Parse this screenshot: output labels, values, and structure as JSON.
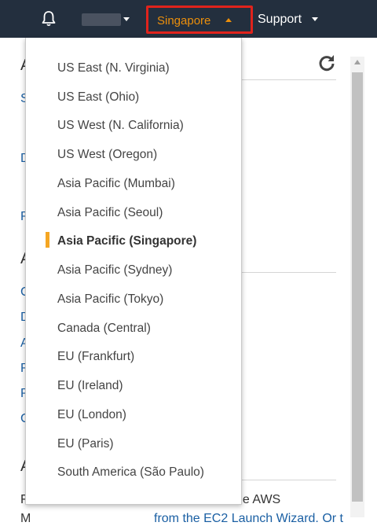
{
  "topnav": {
    "account_label": "",
    "region_label": "Singapore",
    "support_label": "Support"
  },
  "background": {
    "bottom_text_1": "F",
    "bottom_text_1_tail": "ne AWS",
    "bottom_text_2": "M",
    "bottom_text_2_tail": "from the EC2 Launch Wizard. Or t"
  },
  "region_menu": {
    "selected": "Asia Pacific (Singapore)",
    "items": [
      {
        "label": "US East (N. Virginia)"
      },
      {
        "label": "US East (Ohio)"
      },
      {
        "label": "US West (N. California)"
      },
      {
        "label": "US West (Oregon)"
      },
      {
        "label": "Asia Pacific (Mumbai)"
      },
      {
        "label": "Asia Pacific (Seoul)"
      },
      {
        "label": "Asia Pacific (Singapore)"
      },
      {
        "label": "Asia Pacific (Sydney)"
      },
      {
        "label": "Asia Pacific (Tokyo)"
      },
      {
        "label": "Canada (Central)"
      },
      {
        "label": "EU (Frankfurt)"
      },
      {
        "label": "EU (Ireland)"
      },
      {
        "label": "EU (London)"
      },
      {
        "label": "EU (Paris)"
      },
      {
        "label": "South America (São Paulo)"
      }
    ]
  },
  "colors": {
    "topbar": "#232f3e",
    "region_accent": "#ec8f0b",
    "highlight_border": "#e0231c",
    "selected_marker": "#f5a623"
  }
}
